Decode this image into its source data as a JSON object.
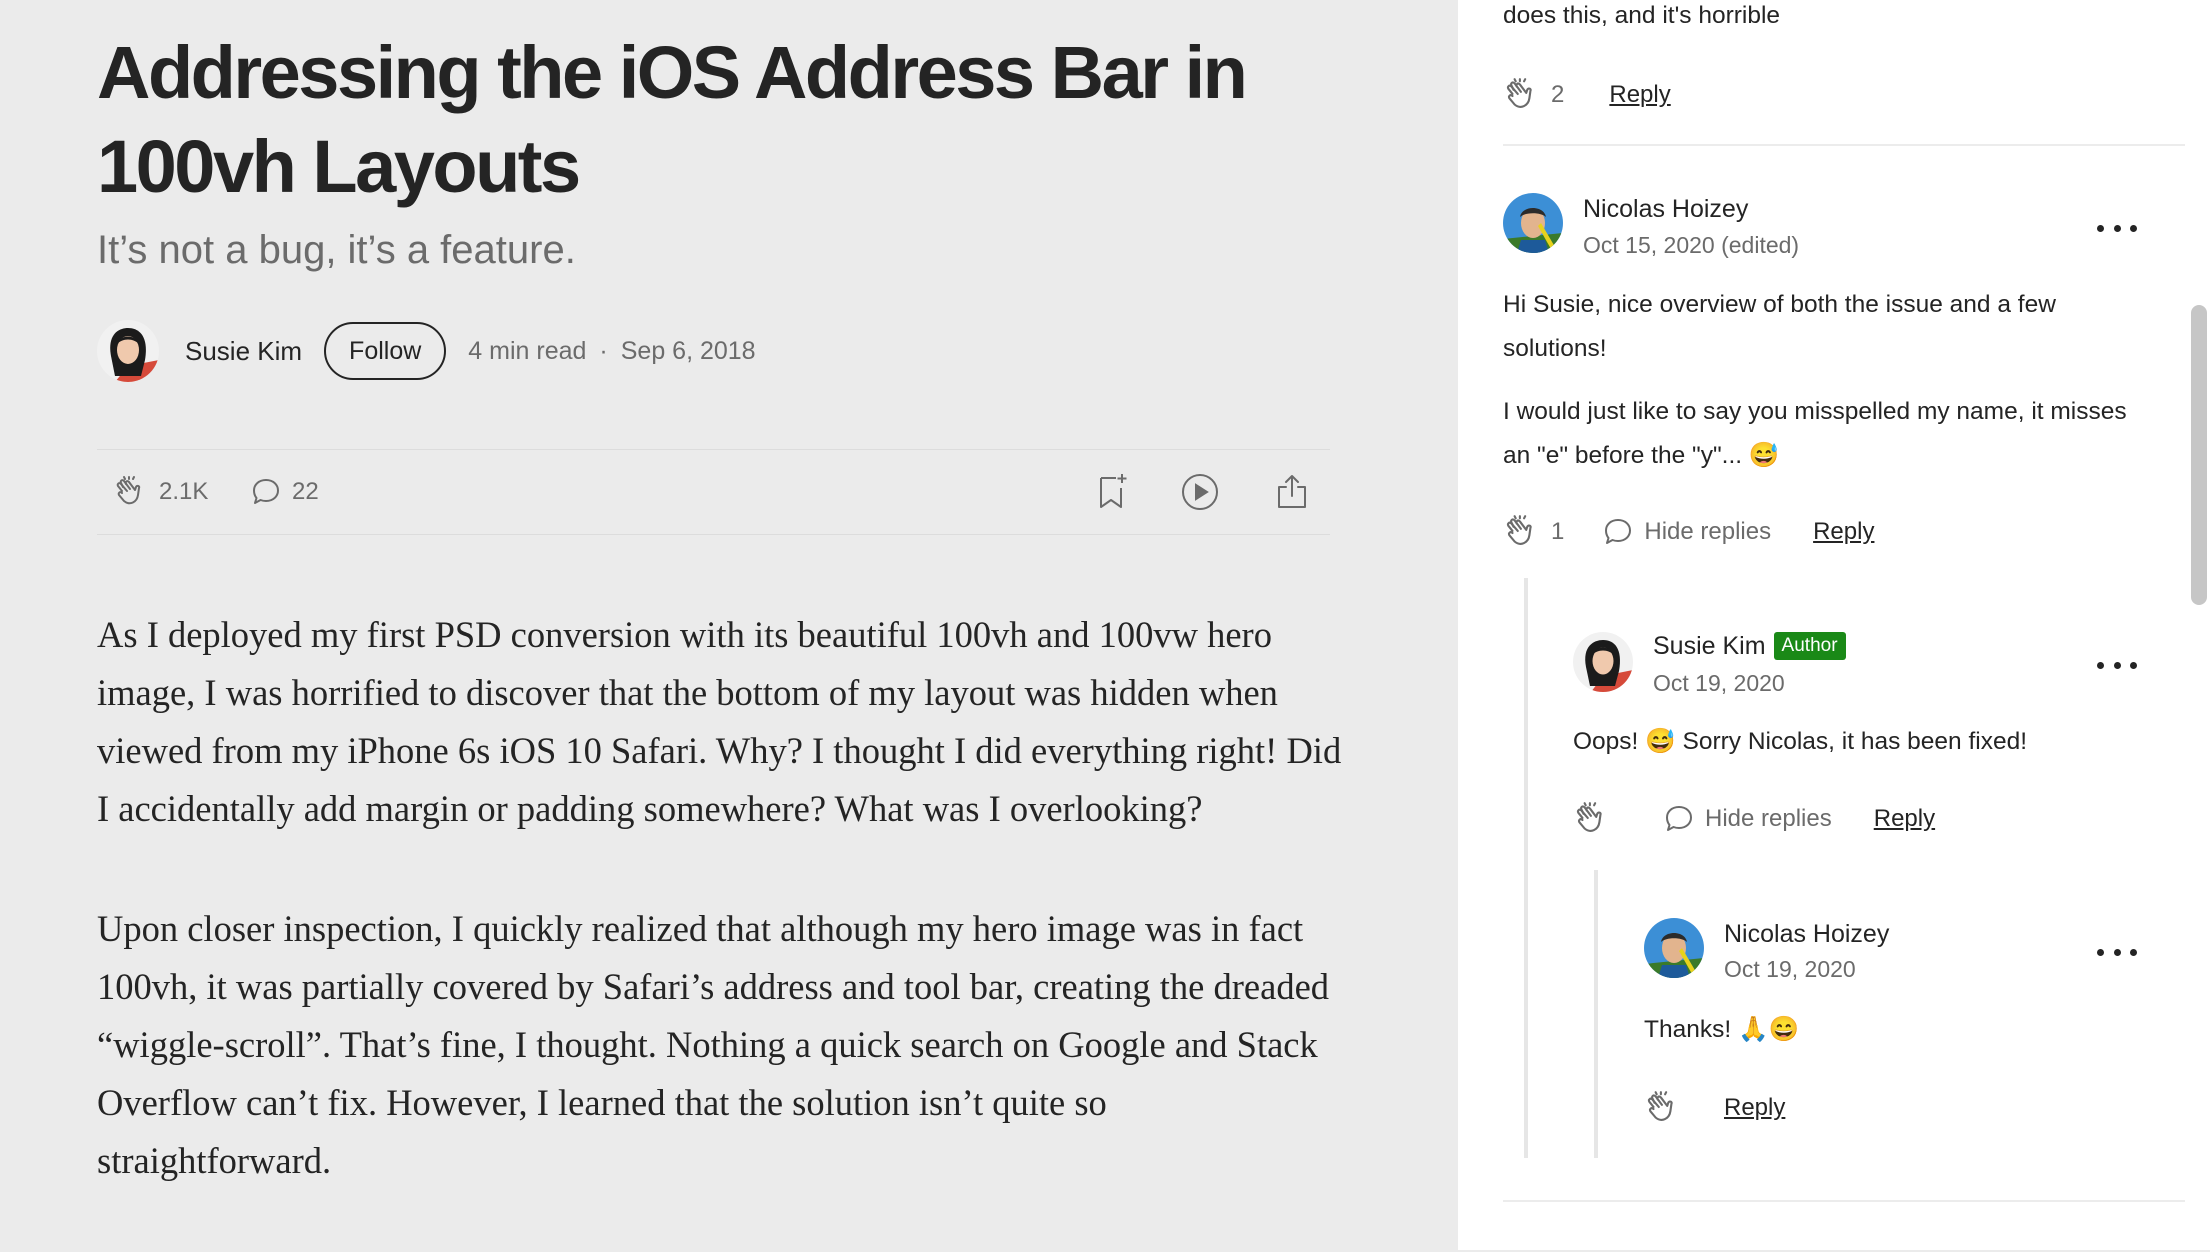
{
  "article": {
    "title": "Addressing the iOS Address Bar in 100vh Layouts",
    "subtitle": "It’s not a bug, it’s a feature.",
    "author": "Susie Kim",
    "follow_label": "Follow",
    "read_time": "4 min read",
    "separator": "·",
    "date": "Sep 6, 2018",
    "claps": "2.1K",
    "responses_count": "22",
    "paragraphs": [
      "As I deployed my first PSD conversion with its beautiful 100vh and 100vw hero image, I was horrified to discover that the bottom of my layout was hidden when viewed from my iPhone 6s iOS 10 Safari. Why? I thought I did everything right! Did I accidentally add margin or padding somewhere? What was I overlooking?",
      "Upon closer inspection, I quickly realized that although my hero image was in fact 100vh, it was partially covered by Safari’s address and tool bar, creating the dreaded “wiggle-scroll”. That’s fine, I thought. Nothing a quick search on Google and Stack Overflow can’t fix. However, I learned that the solution isn’t quite so straightforward."
    ]
  },
  "responses": {
    "prev_comment": {
      "text_tail": "does this, and it's horrible",
      "claps": "2",
      "reply_label": "Reply"
    },
    "comment1": {
      "name": "Nicolas Hoizey",
      "date": "Oct 15, 2020 (edited)",
      "paragraphs": [
        "Hi Susie, nice overview of both the issue and a few solutions!",
        "I would just like to say you misspelled my name, it misses an \"e\" before the \"y\"... 😅"
      ],
      "claps": "1",
      "hide_replies_label": "Hide replies",
      "reply_label": "Reply"
    },
    "reply1": {
      "name": "Susie Kim",
      "badge": "Author",
      "date": "Oct 19, 2020",
      "text": "Oops! 😅 Sorry Nicolas, it has been fixed!",
      "hide_replies_label": "Hide replies",
      "reply_label": "Reply"
    },
    "reply2": {
      "name": "Nicolas Hoizey",
      "date": "Oct 19, 2020",
      "text": "Thanks! 🙏😄",
      "reply_label": "Reply"
    }
  },
  "icons": {
    "clap": "clap-icon",
    "comment": "comment-bubble-icon",
    "bookmark": "bookmark-add-icon",
    "play": "play-icon",
    "share": "share-icon",
    "more": "more-options-icon"
  },
  "colors": {
    "article_bg": "#ebebeb",
    "panel_bg": "#ffffff",
    "text": "#242424",
    "muted": "#6b6b6b",
    "author_badge": "#1a8917"
  }
}
